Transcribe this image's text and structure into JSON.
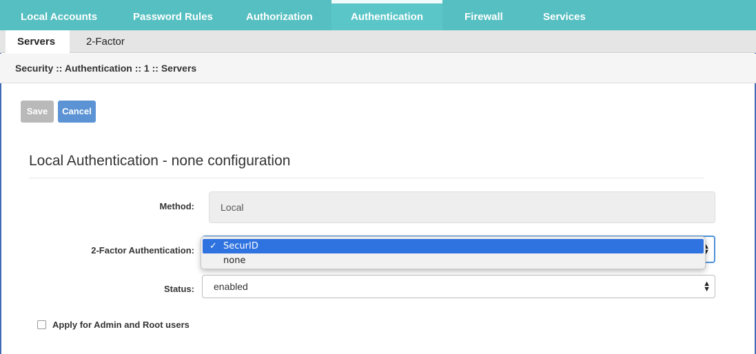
{
  "top_tabs": [
    {
      "label": "Local Accounts"
    },
    {
      "label": "Password Rules"
    },
    {
      "label": "Authorization"
    },
    {
      "label": "Authentication",
      "active": true
    },
    {
      "label": "Firewall"
    },
    {
      "label": "Services"
    }
  ],
  "sub_tabs": [
    {
      "label": "Servers",
      "active": true
    },
    {
      "label": "2-Factor"
    }
  ],
  "breadcrumb": "Security :: Authentication :: 1 :: Servers",
  "toolbar": {
    "save_label": "Save",
    "cancel_label": "Cancel",
    "save_disabled": true
  },
  "section_title": "Local Authentication - none configuration",
  "form": {
    "method_label": "Method:",
    "method_value": "Local",
    "two_factor_label": "2-Factor Authentication:",
    "two_factor_options": [
      {
        "label": "SecurID",
        "selected": true
      },
      {
        "label": "none"
      }
    ],
    "status_label": "Status:",
    "status_value": "enabled",
    "apply_admin_label": "Apply for Admin and Root users",
    "apply_admin_checked": false
  },
  "colors": {
    "tab_bar": "#56bfc1",
    "primary_button": "#5b93d5",
    "disabled_button": "#b9b9b9",
    "dropdown_highlight": "#2f73e0"
  },
  "icons": {
    "checkmark": "check-icon",
    "select_arrows": "select-arrows-icon"
  }
}
